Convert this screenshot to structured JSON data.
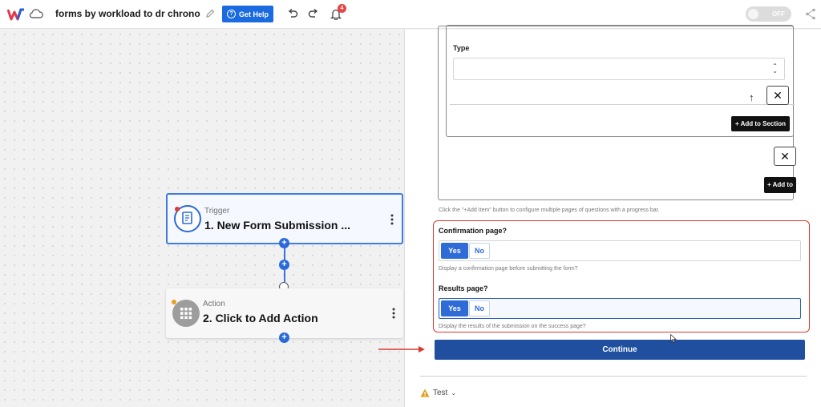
{
  "header": {
    "title": "forms by workload to dr chrono",
    "help_label": "Get Help",
    "notification_count": "4",
    "toggle_label": "OFF"
  },
  "canvas": {
    "trigger": {
      "kind": "Trigger",
      "title": "1. New Form Submission ..."
    },
    "action": {
      "kind": "Action",
      "title": "2. Click to Add Action"
    }
  },
  "panel": {
    "type_label": "Type",
    "add_to_section_label": "+ Add to Section",
    "add_to_label": "+ Add to",
    "add_item_hint": "Click the \"+Add Item\" button to configure multiple pages of questions with a progress bar.",
    "confirmation": {
      "label": "Confirmation page?",
      "yes": "Yes",
      "no": "No",
      "hint": "Display a confirmation page before submitting the form?"
    },
    "results": {
      "label": "Results page?",
      "yes": "Yes",
      "no": "No",
      "hint": "Display the results of the submission on the success page?"
    },
    "continue_label": "Continue",
    "test_label": "Test"
  },
  "colors": {
    "primary": "#2f6bd6",
    "continue": "#1f4f9e",
    "highlight": "#d9382e"
  }
}
